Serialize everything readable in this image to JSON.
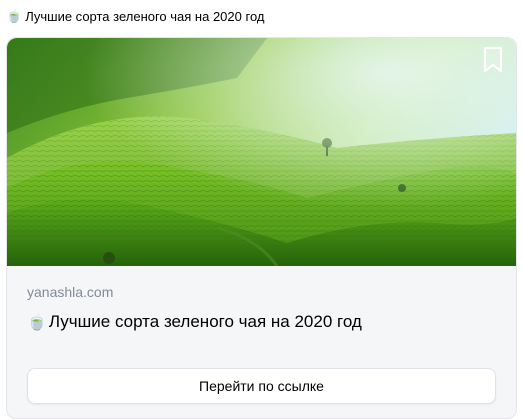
{
  "post": {
    "emoji": "🍵",
    "text": "Лучшие сорта зеленого чая на 2020 год"
  },
  "card": {
    "image_alt": "tea-plantation-hills",
    "bookmark_icon": "bookmark-icon",
    "domain": "yanashla.com",
    "title_emoji": "🍵",
    "title": "Лучшие сорта зеленого чая на 2020 год",
    "button_label": "Перейти по ссылке"
  }
}
